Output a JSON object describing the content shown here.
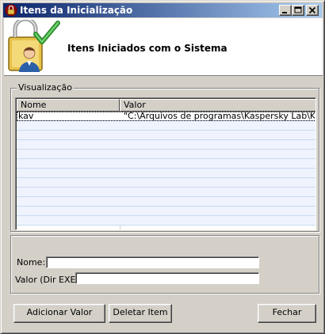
{
  "window": {
    "title": "Itens da Inicialização"
  },
  "header": {
    "title": "Itens Iniciados com o Sistema"
  },
  "group": {
    "label": "Visualização"
  },
  "list": {
    "columns": [
      "Nome",
      "Valor"
    ],
    "rows": [
      {
        "name": "kav",
        "value": "\"C:\\Arquivos de programas\\Kaspersky Lab\\Kas..."
      }
    ]
  },
  "form": {
    "name_label": "Nome:",
    "name_value": "",
    "value_label": "Valor (Dir EXE)",
    "value_value": ""
  },
  "buttons": {
    "add": "Adicionar Valor",
    "delete": "Deletar Item",
    "close": "Fechar"
  },
  "colors": {
    "titlebar_start": "#0a246a",
    "titlebar_end": "#a6caf0",
    "face": "#d4d0c8",
    "row_alt": "#eef3fd"
  }
}
